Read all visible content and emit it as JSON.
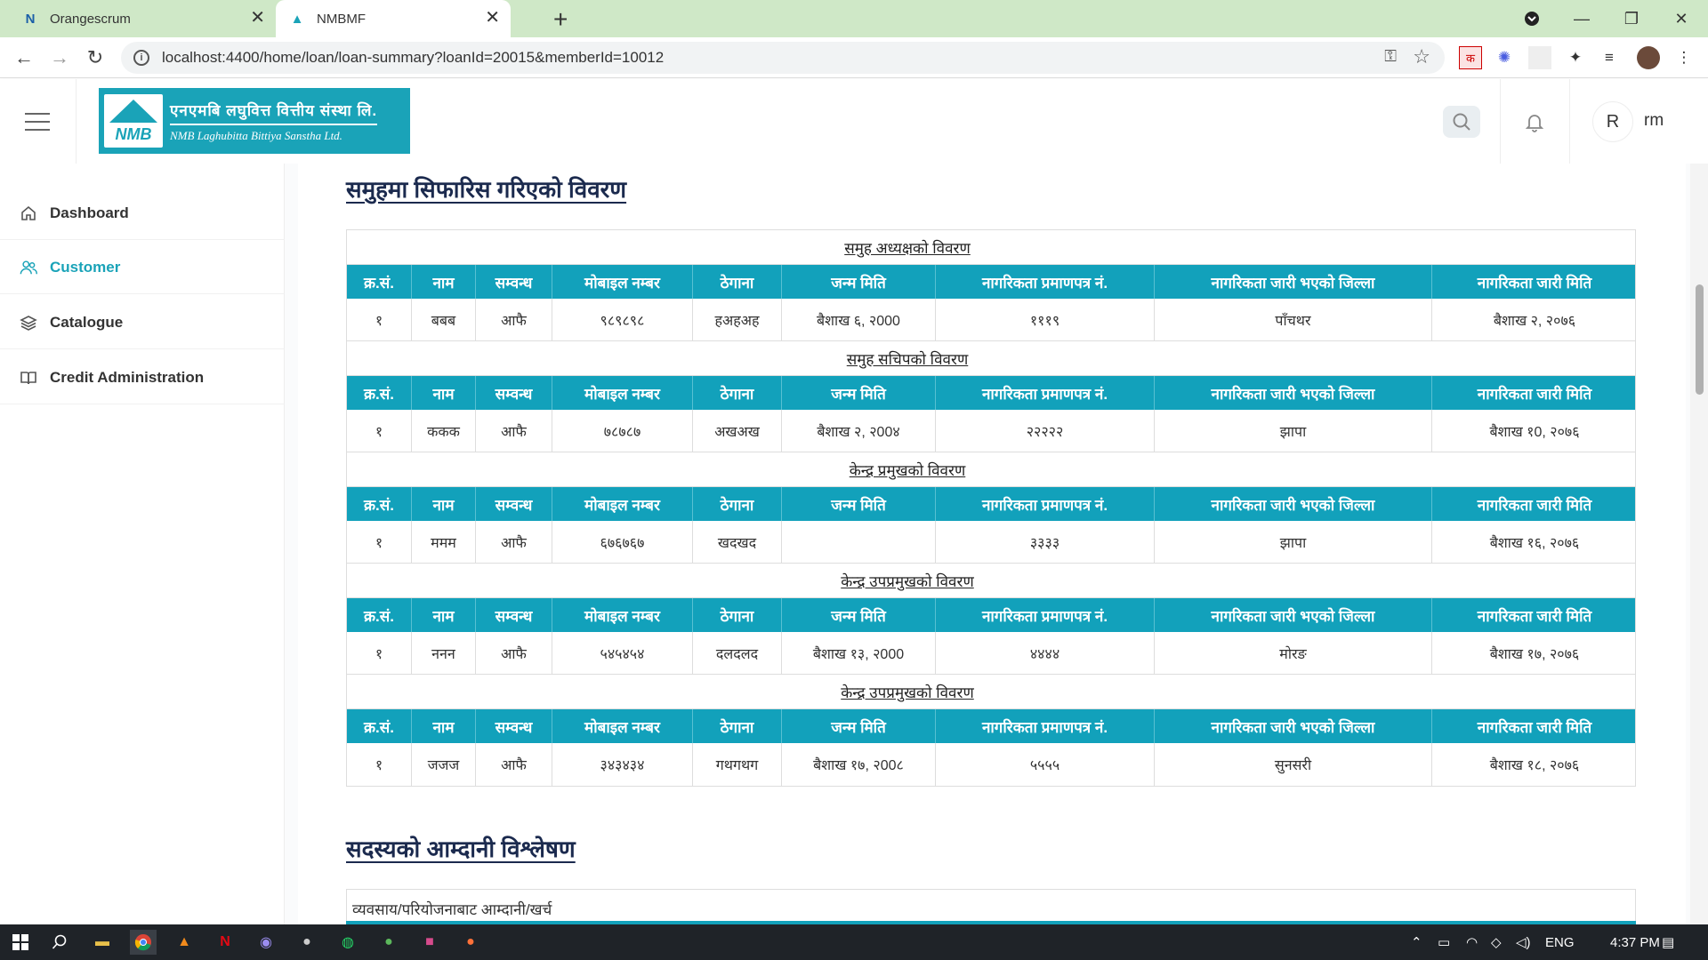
{
  "browser": {
    "tabs": [
      {
        "title": "Orangescrum",
        "icon": "orangescrum-icon"
      },
      {
        "title": "NMBMF",
        "icon": "nmb-icon"
      }
    ],
    "url": "localhost:4400/home/loan/loan-summary?loanId=20015&memberId=10012"
  },
  "header": {
    "logo_nepali": "एनएमबि लघुवित्त वित्तीय संस्था लि.",
    "logo_english": "NMB Laghubitta Bittiya Sanstha Ltd.",
    "logo_mark": "NMB",
    "avatar_initial": "R",
    "user_name": "rm"
  },
  "sidebar": {
    "items": [
      {
        "label": "Dashboard",
        "icon": "home-icon"
      },
      {
        "label": "Customer",
        "icon": "users-icon",
        "active": true
      },
      {
        "label": "Catalogue",
        "icon": "layers-icon"
      },
      {
        "label": "Credit Administration",
        "icon": "book-icon"
      }
    ]
  },
  "main": {
    "section_title": "समुहमा सिफारिस गरिएको विवरण",
    "columns": [
      "क्र.सं.",
      "नाम",
      "सम्वन्ध",
      "मोबाइल नम्बर",
      "ठेगाना",
      "जन्म मिति",
      "नागरिकता प्रमाणपत्र नं.",
      "नागरिकता जारी भएको जिल्ला",
      "नागरिकता जारी मिति"
    ],
    "groups": [
      {
        "caption": "समुह अध्यक्षको विवरण",
        "row": [
          "१",
          "बबब",
          "आफै",
          "९८९८९८",
          "हअहअह",
          "बैशाख ६, २000",
          "१११९",
          "पाँचथर",
          "बैशाख २, २०७६"
        ]
      },
      {
        "caption": "समुह सचिपको विवरण",
        "row": [
          "१",
          "ककक",
          "आफै",
          "७८७८७",
          "अखअख",
          "बैशाख २, २00४",
          "२२२२२",
          "झापा",
          "बैशाख १0, २०७६"
        ]
      },
      {
        "caption": "केन्द्र प्रमुखको विवरण",
        "row": [
          "१",
          "ममम",
          "आफै",
          "६७६७६७",
          "खदखद",
          "",
          "३३३३",
          "झापा",
          "बैशाख १६, २०७६"
        ]
      },
      {
        "caption": "केन्द्र उपप्रमुखको विवरण",
        "row": [
          "१",
          "ननन",
          "आफै",
          "५४५४५४",
          "दलदलद",
          "बैशाख १३, २000",
          "४४४४",
          "मोरङ",
          "बैशाख १७, २०७६"
        ]
      },
      {
        "caption": "केन्द्र उपप्रमुखको विवरण",
        "row": [
          "१",
          "जजज",
          "आफै",
          "३४३४३४",
          "गथगथग",
          "बैशाख १७, २00८",
          "५५५५",
          "सुनसरी",
          "बैशाख १८, २०७६"
        ]
      }
    ],
    "income_title": "सदस्यको आम्दानी विश्लेषण",
    "income_subtitle": "व्यवसाय/परियोजनाबाट आम्दानी/खर्च"
  },
  "taskbar": {
    "lang": "ENG",
    "time": "4:37 PM"
  },
  "colors": {
    "accent": "#12a1bb",
    "title": "#1b2a4e",
    "tab_strip": "#cfe8c7"
  }
}
